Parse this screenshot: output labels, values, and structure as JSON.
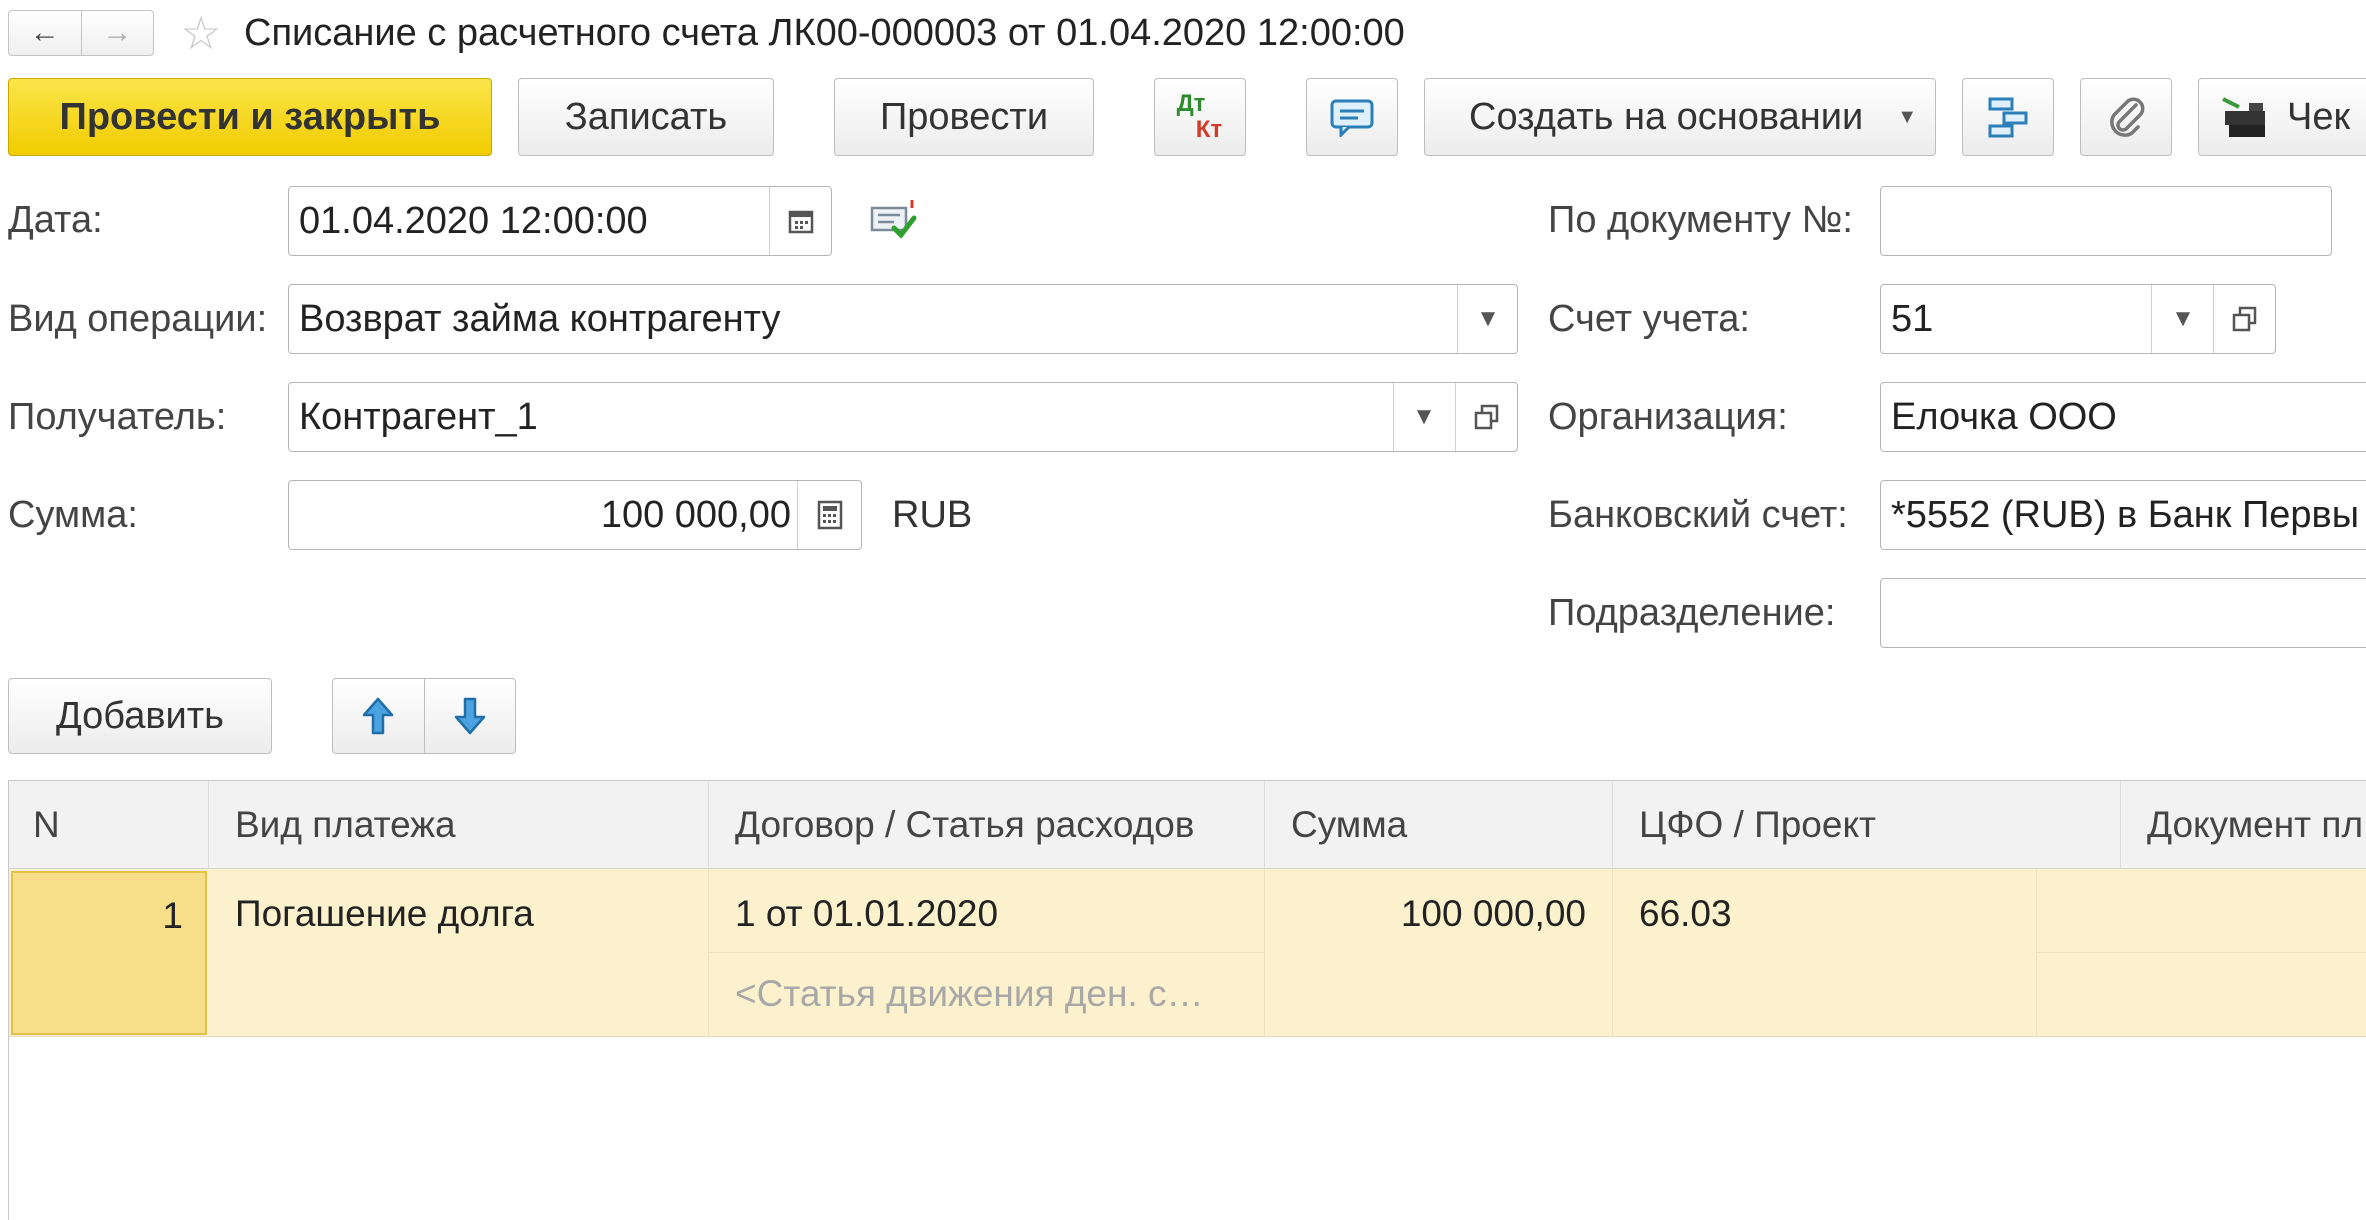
{
  "header": {
    "title": "Списание с расчетного счета ЛК00-000003 от 01.04.2020 12:00:00"
  },
  "toolbar": {
    "post_close_label": "Провести и закрыть",
    "save_label": "Записать",
    "post_label": "Провести",
    "dt_label": "Дт",
    "kt_label": "Кт",
    "create_based_label": "Создать на основании",
    "check_label": "Чек"
  },
  "form": {
    "date_label": "Дата:",
    "date_value": "01.04.2020 12:00:00",
    "operation_label": "Вид операции:",
    "operation_value": "Возврат займа контрагенту",
    "recipient_label": "Получатель:",
    "recipient_value": "Контрагент_1",
    "amount_label": "Сумма:",
    "amount_value": "100 000,00",
    "currency": "RUB",
    "doc_number_label": "По документу №:",
    "doc_number_value": "",
    "account_label": "Счет учета:",
    "account_value": "51",
    "organization_label": "Организация:",
    "organization_value": "Елочка ООО",
    "bank_account_label": "Банковский счет:",
    "bank_account_value": "*5552 (RUB) в Банк Первы",
    "division_label": "Подразделение:",
    "division_value": ""
  },
  "table_toolbar": {
    "add_label": "Добавить"
  },
  "table": {
    "columns": [
      "N",
      "Вид платежа",
      "Договор / Статья расходов",
      "Сумма",
      "ЦФО / Проект",
      "Документ пл"
    ],
    "rows": [
      {
        "n": "1",
        "payment_type": "Погашение долга",
        "contract": "1 от 01.01.2020",
        "expense_item": "<Статья движения ден. с…",
        "amount": "100 000,00",
        "cfo": "66.03",
        "document": ""
      }
    ]
  },
  "colors": {
    "primary_button": "#f5d40f",
    "selected_row": "#fbf1cd",
    "selected_cell": "#f7df8a",
    "header_bg": "#f2f2f2"
  }
}
